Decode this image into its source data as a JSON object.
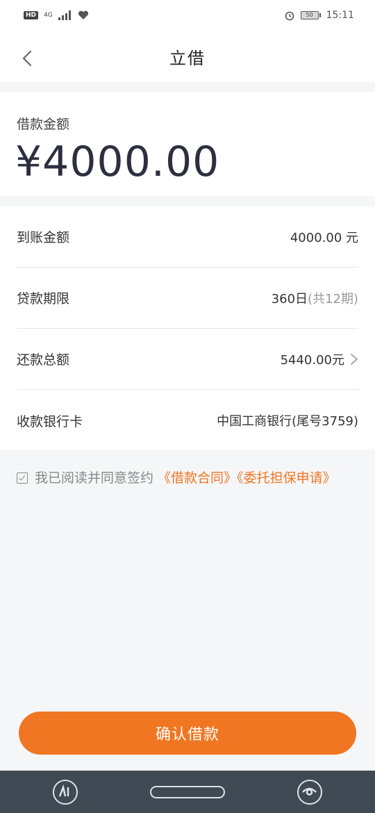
{
  "status_bar": {
    "hd": "HD",
    "network": "4G",
    "battery": "50",
    "time": "15:11"
  },
  "nav": {
    "title": "立借"
  },
  "amount": {
    "label": "借款金额",
    "value": "¥4000.00"
  },
  "details": [
    {
      "label": "到账金额",
      "value": "4000.00 元",
      "suffix": ""
    },
    {
      "label": "贷款期限",
      "value": "360日",
      "suffix": "(共12期)"
    },
    {
      "label": "还款总额",
      "value": "5440.00元",
      "suffix": ""
    },
    {
      "label": "收款银行卡",
      "value": "中国工商银行(尾号3759)",
      "suffix": ""
    }
  ],
  "agreement": {
    "prefix": "我已阅读并同意签约 ",
    "link1": "《借款合同》",
    "link2": "《委托担保申请》",
    "checked": true
  },
  "confirm_button": "确认借款",
  "colors": {
    "accent": "#f07621",
    "nav_bar": "#3f4a55"
  }
}
